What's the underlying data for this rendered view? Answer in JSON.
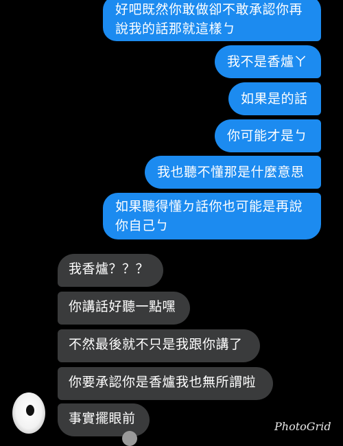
{
  "conversation": {
    "sent": [
      {
        "lines": [
          "好吧既然你敢做卻不敢承認你再",
          "說我的話那就這樣ㄅ"
        ]
      },
      {
        "lines": [
          "我不是香爐ㄚ"
        ]
      },
      {
        "lines": [
          "如果是的話"
        ]
      },
      {
        "lines": [
          "你可能才是ㄅ"
        ]
      },
      {
        "lines": [
          "我也聽不懂那是什麼意思"
        ]
      },
      {
        "lines": [
          "如果聽得懂ㄉ話你也可能是再說",
          "你自己ㄅ"
        ]
      }
    ],
    "received": [
      {
        "text": "我香爐？？？"
      },
      {
        "text": "你講話好聽一點嘿"
      },
      {
        "text": "不然最後就不只是我跟你講了"
      },
      {
        "text": "你要承認你是香爐我也無所謂啦"
      },
      {
        "text": "事實擺眼前"
      }
    ]
  },
  "watermark": "PhotoGrid",
  "colors": {
    "background": "#000000",
    "sent_bubble": "#1c8bf0",
    "received_bubble": "#3a3b3c",
    "text": "#ffffff"
  }
}
